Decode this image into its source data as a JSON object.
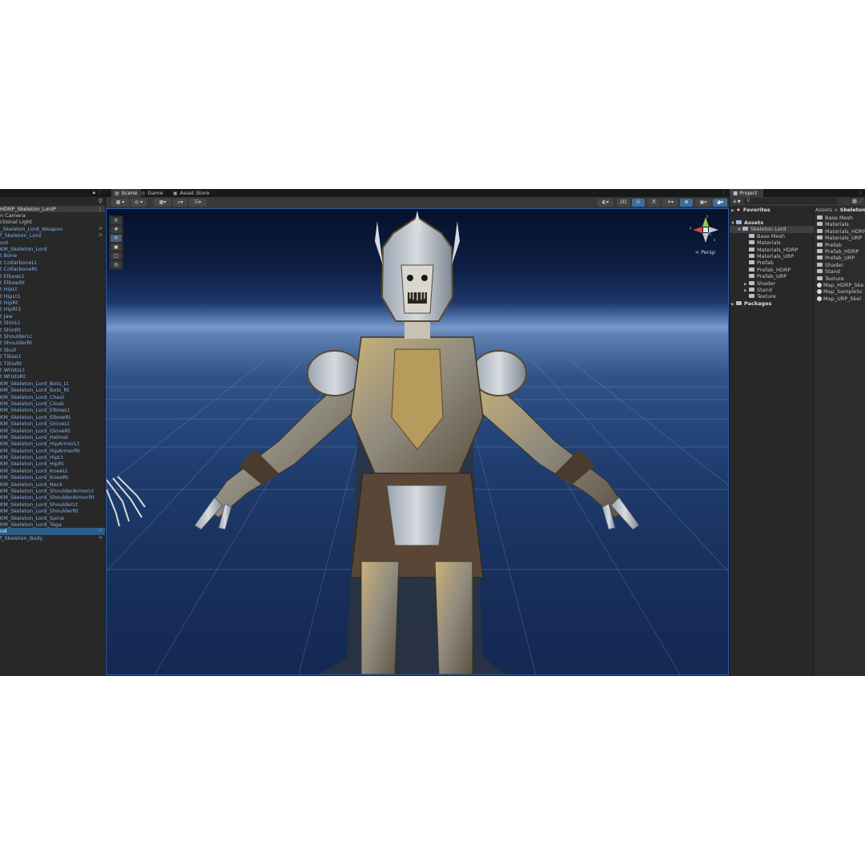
{
  "hierarchy": {
    "scene_name": "HDRP_Skeleton_Lord*",
    "items": [
      {
        "label": "n Camera",
        "plain": true
      },
      {
        "label": "ctional Light",
        "plain": true
      },
      {
        "label": "_Skeleton_Lord_Weapon",
        "arrow": ">"
      },
      {
        "label": "f_Skeleton_Lord",
        "arrow": ">"
      },
      {
        "label": "oot"
      },
      {
        "label": "KM_Skeleton_Lord"
      },
      {
        "label": "t Bone"
      },
      {
        "label": "t CollarboneLt"
      },
      {
        "label": "t CollarboneRt"
      },
      {
        "label": "t ElbowLt"
      },
      {
        "label": "t ElbowRt"
      },
      {
        "label": "t HipLt"
      },
      {
        "label": "t HipLt1"
      },
      {
        "label": "t HipRt"
      },
      {
        "label": "t HipRt1"
      },
      {
        "label": "t Jaw"
      },
      {
        "label": "t ShinLt"
      },
      {
        "label": "t ShinRt"
      },
      {
        "label": "t ShoulderLt"
      },
      {
        "label": "t ShoulderRt"
      },
      {
        "label": "t Skull"
      },
      {
        "label": "t TibiaLt"
      },
      {
        "label": "t TibiaRt"
      },
      {
        "label": "t WristsLt"
      },
      {
        "label": "t WristsRt"
      },
      {
        "label": "KM_Skeleton_Lord_Bots_Lt"
      },
      {
        "label": "KM_Skeleton_Lord_Bots_Rt"
      },
      {
        "label": "KM_Skeleton_Lord_Chest"
      },
      {
        "label": "KM_Skeleton_Lord_Cloak"
      },
      {
        "label": "KM_Skeleton_Lord_ElbowLt"
      },
      {
        "label": "KM_Skeleton_Lord_ElbowRt"
      },
      {
        "label": "KM_Skeleton_Lord_GloveLt"
      },
      {
        "label": "KM_Skeleton_Lord_GloveRt"
      },
      {
        "label": "KM_Skeleton_Lord_Helmet"
      },
      {
        "label": "KM_Skeleton_Lord_HipArmorLt"
      },
      {
        "label": "KM_Skeleton_Lord_HipArmorRt"
      },
      {
        "label": "KM_Skeleton_Lord_HipLt"
      },
      {
        "label": "KM_Skeleton_Lord_HipRt"
      },
      {
        "label": "KM_Skeleton_Lord_KneeLt"
      },
      {
        "label": "KM_Skeleton_Lord_KneeRt"
      },
      {
        "label": "KM_Skeleton_Lord_Neck"
      },
      {
        "label": "KM_Skeleton_Lord_ShoulderArmorLt"
      },
      {
        "label": "KM_Skeleton_Lord_ShoulderArmorRt"
      },
      {
        "label": "KM_Skeleton_Lord_ShoulderLt"
      },
      {
        "label": "KM_Skeleton_Lord_ShoulderRt"
      },
      {
        "label": "KM_Skeleton_Lord_Spine"
      },
      {
        "label": "KM_Skeleton_Lord_Toga"
      },
      {
        "label": "nd",
        "selected": true,
        "plain": true,
        "arrow": ">"
      },
      {
        "label": "f_Skeleton_Body",
        "arrow": ">"
      }
    ]
  },
  "scene_view": {
    "tabs": [
      {
        "label": "Scene",
        "icon": "grid-icon",
        "active": true
      },
      {
        "label": "Game",
        "icon": "gamepad-icon",
        "active": false
      },
      {
        "label": "Asset Store",
        "icon": "store-icon",
        "active": false
      }
    ],
    "toolbar": {
      "mode_2d_label": "2D"
    },
    "camera_label": "< Persp",
    "gizmo_axes": {
      "y": "y",
      "x": "x",
      "z": "z"
    }
  },
  "project": {
    "tab_label": "Project",
    "search_placeholder": "",
    "favorites_label": "Favorites",
    "tree": [
      {
        "label": "Assets",
        "depth": 0,
        "bold": true,
        "open": true
      },
      {
        "label": "Skeleton Lord",
        "depth": 1,
        "open": true,
        "selected": true
      },
      {
        "label": "Base Mesh",
        "depth": 2
      },
      {
        "label": "Materials",
        "depth": 2
      },
      {
        "label": "Materials_HDRP",
        "depth": 2
      },
      {
        "label": "Materials_URP",
        "depth": 2
      },
      {
        "label": "Prefab",
        "depth": 2
      },
      {
        "label": "Prefab_HDRP",
        "depth": 2
      },
      {
        "label": "Prefab_URP",
        "depth": 2
      },
      {
        "label": "Shader",
        "depth": 2,
        "caret": true
      },
      {
        "label": "Stand",
        "depth": 2,
        "caret": true
      },
      {
        "label": "Texture",
        "depth": 2
      },
      {
        "label": "Packages",
        "depth": 0,
        "bold": true,
        "caret": true
      }
    ],
    "breadcrumb": {
      "root": "Assets",
      "sep": ">",
      "current": "Skeleton Lo"
    },
    "contents": [
      {
        "label": "Base Mesh",
        "kind": "folder"
      },
      {
        "label": "Materials",
        "kind": "folder"
      },
      {
        "label": "Materials_HDRP",
        "kind": "folder"
      },
      {
        "label": "Materials_URP",
        "kind": "folder"
      },
      {
        "label": "Prefab",
        "kind": "folder"
      },
      {
        "label": "Prefab_HDRP",
        "kind": "folder"
      },
      {
        "label": "Prefab_URP",
        "kind": "folder"
      },
      {
        "label": "Shader",
        "kind": "folder"
      },
      {
        "label": "Stand",
        "kind": "folder"
      },
      {
        "label": "Texture",
        "kind": "folder"
      },
      {
        "label": "Map_HDRP_Ske",
        "kind": "scene"
      },
      {
        "label": "Map_SampleSc",
        "kind": "scene"
      },
      {
        "label": "Map_URP_Skel",
        "kind": "scene"
      }
    ]
  },
  "colors": {
    "editor_bg": "#191919",
    "panel_bg": "#282828",
    "selection": "#2c5d87",
    "prefab_text": "#7fb0ea",
    "viewport_sky": "#0d1f46",
    "viewport_horizon": "#7999c6"
  }
}
